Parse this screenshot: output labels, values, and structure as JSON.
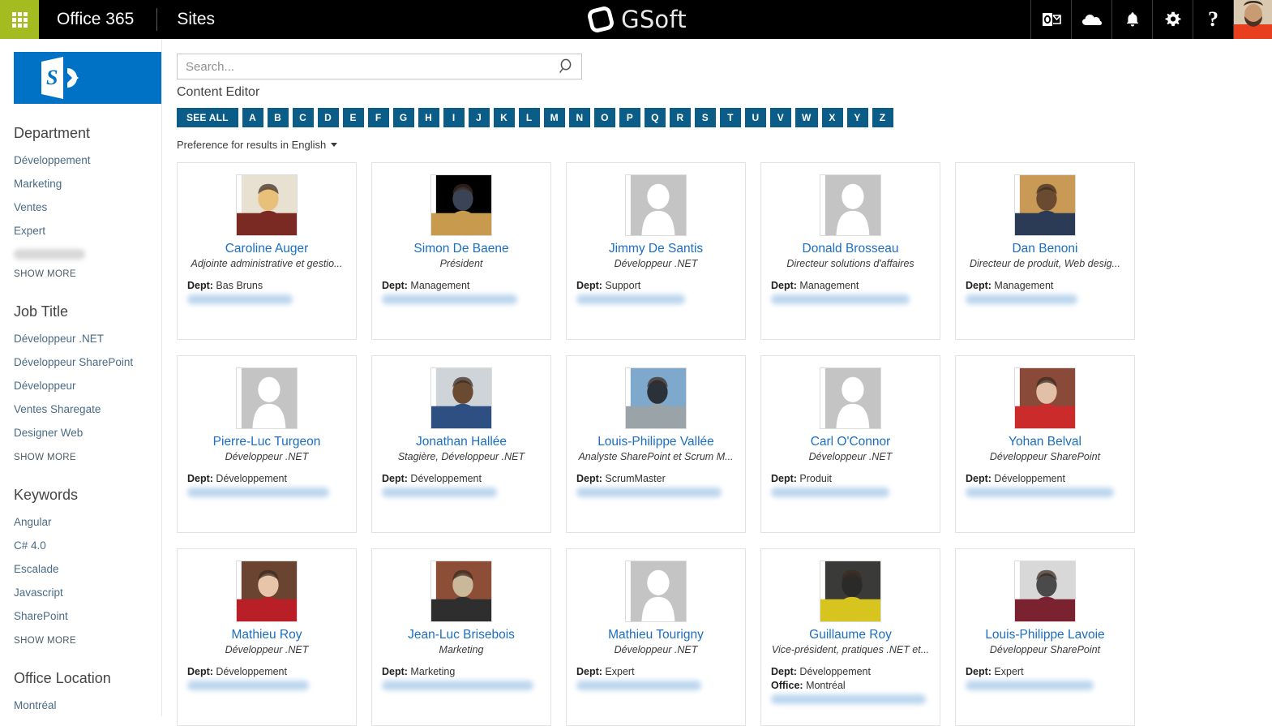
{
  "suitebar": {
    "waffle_label": "app-launcher",
    "brand": "Office 365",
    "site": "Sites",
    "logo_text": "GSoft",
    "icons": [
      "outlook-icon",
      "onedrive-icon",
      "notifications-bell-icon",
      "settings-gear-icon",
      "help-icon"
    ],
    "help_glyph": "?",
    "avatar_label": "user-avatar"
  },
  "leftnav": {
    "logo_label": "SharePoint",
    "groups": [
      {
        "title": "Department",
        "items": [
          "Développement",
          "Marketing",
          "Ventes",
          "Expert"
        ],
        "redacted_items": 1,
        "show_more": "SHOW MORE"
      },
      {
        "title": "Job Title",
        "items": [
          "Développeur .NET",
          "Développeur SharePoint",
          "Développeur",
          "Ventes Sharegate",
          "Designer Web"
        ],
        "redacted_items": 0,
        "show_more": "SHOW MORE"
      },
      {
        "title": "Keywords",
        "items": [
          "Angular",
          "C# 4.0",
          "Escalade",
          "Javascript",
          "SharePoint"
        ],
        "redacted_items": 0,
        "show_more": "SHOW MORE"
      },
      {
        "title": "Office Location",
        "items": [
          "Montréal"
        ],
        "redacted_items": 0,
        "show_more": ""
      }
    ]
  },
  "search": {
    "value": "",
    "placeholder": "Search...",
    "button_label": "search-icon"
  },
  "webpart_title": "Content Editor",
  "alpha_nav": [
    "SEE ALL",
    "A",
    "B",
    "C",
    "D",
    "E",
    "F",
    "G",
    "H",
    "I",
    "J",
    "K",
    "L",
    "M",
    "N",
    "O",
    "P",
    "Q",
    "R",
    "S",
    "T",
    "U",
    "V",
    "W",
    "X",
    "Y",
    "Z"
  ],
  "preference": {
    "text": "Preference for results in English"
  },
  "labels": {
    "dept": "Dept:",
    "office": "Office:"
  },
  "people": [
    {
      "name": "Caroline Auger",
      "title": "Adjointe administrative et gestio...",
      "dept": "Bas Bruns",
      "office": "",
      "photo": "photo",
      "photo_colors": [
        "#e8e1d2",
        "#7a2a22",
        "#e8c07a"
      ]
    },
    {
      "name": "Simon De Baene",
      "title": "Président",
      "dept": "Management",
      "office": "",
      "photo": "photo",
      "photo_colors": [
        "#d9a martinez",
        "#c79a4e",
        "#3b4456"
      ]
    },
    {
      "name": "Jimmy De Santis",
      "title": "Développeur .NET",
      "dept": "Support",
      "office": "",
      "photo": "placeholder",
      "photo_colors": []
    },
    {
      "name": "Donald Brosseau",
      "title": "Directeur solutions d'affaires",
      "dept": "Management",
      "office": "",
      "photo": "placeholder",
      "photo_colors": []
    },
    {
      "name": "Dan Benoni",
      "title": "Directeur de produit, Web desig...",
      "dept": "Management",
      "office": "",
      "photo": "photo",
      "photo_colors": [
        "#c89a55",
        "#2b3a55",
        "#6b4a32"
      ]
    },
    {
      "name": "Pierre-Luc Turgeon",
      "title": "Développeur .NET",
      "dept": "Développement",
      "office": "",
      "photo": "placeholder",
      "photo_colors": []
    },
    {
      "name": "Jonathan Hallée",
      "title": "Stagière, Développeur .NET",
      "dept": "Développement",
      "office": "",
      "photo": "photo",
      "photo_colors": [
        "#cfd4d8",
        "#2d4f82",
        "#6b4a32"
      ]
    },
    {
      "name": "Louis-Philippe Vallée",
      "title": "Analyste SharePoint et Scrum M...",
      "dept": "ScrumMaster",
      "office": "",
      "photo": "photo",
      "photo_colors": [
        "#7fa9cc",
        "#9aa3a8",
        "#2b3138"
      ]
    },
    {
      "name": "Carl O'Connor",
      "title": "Développeur .NET",
      "dept": "Produit",
      "office": "",
      "photo": "placeholder",
      "photo_colors": []
    },
    {
      "name": "Yohan Belval",
      "title": "Développeur SharePoint",
      "dept": "Développement",
      "office": "",
      "photo": "photo",
      "photo_colors": [
        "#8a4a3a",
        "#cc2b2b",
        "#e2c0a8"
      ]
    },
    {
      "name": "Mathieu Roy",
      "title": "Développeur .NET",
      "dept": "Développement",
      "office": "",
      "photo": "photo",
      "photo_colors": [
        "#6a4430",
        "#b81f26",
        "#e6c5a8"
      ]
    },
    {
      "name": "Jean-Luc Brisebois",
      "title": "Marketing",
      "dept": "Marketing",
      "office": "",
      "photo": "photo",
      "photo_colors": [
        "#8c4e36",
        "#2e2e2e",
        "#c9b89a"
      ]
    },
    {
      "name": "Mathieu Tourigny",
      "title": "Développeur .NET",
      "dept": "Expert",
      "office": "",
      "photo": "placeholder",
      "photo_colors": []
    },
    {
      "name": "Guillaume Roy",
      "title": "Vice-président, pratiques .NET et...",
      "dept": "Développement",
      "office": "Montréal",
      "photo": "photo",
      "photo_colors": [
        "#3a3a38",
        "#d8c41f",
        "#2a2a28"
      ]
    },
    {
      "name": "Louis-Philippe Lavoie",
      "title": "Développeur SharePoint",
      "dept": "Expert",
      "office": "",
      "photo": "photo",
      "photo_colors": [
        "#d8d8d8",
        "#7a2230",
        "#4a4a4a"
      ]
    }
  ]
}
